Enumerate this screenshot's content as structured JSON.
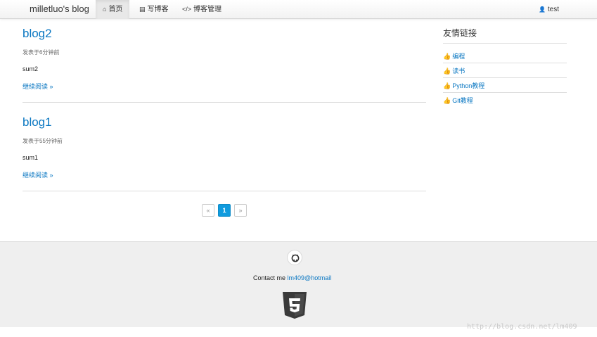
{
  "navbar": {
    "brand": "milletluo's blog",
    "items": [
      {
        "label": "首页",
        "icon": "home-icon",
        "glyph": "⌂",
        "active": true
      },
      {
        "label": "写博客",
        "icon": "book-icon",
        "glyph": "▤",
        "active": false
      },
      {
        "label": "博客管理",
        "icon": "code-icon",
        "glyph": "</>",
        "active": false
      }
    ],
    "user": {
      "icon": "user-icon",
      "glyph": "👤",
      "name": "test"
    }
  },
  "posts": [
    {
      "title": "blog2",
      "meta": "发表于6分钟前",
      "summary": "sum2",
      "read_more": "继续阅读 »"
    },
    {
      "title": "blog1",
      "meta": "发表于55分钟前",
      "summary": "sum1",
      "read_more": "继续阅读 »"
    }
  ],
  "pagination": {
    "prev": "«",
    "current": "1",
    "next": "»"
  },
  "sidebar": {
    "title": "友情链接",
    "links": [
      {
        "label": "编程",
        "icon": "thumbs-up-icon"
      },
      {
        "label": "读书",
        "icon": "thumbs-up-icon"
      },
      {
        "label": "Python教程",
        "icon": "thumbs-up-icon"
      },
      {
        "label": "Git教程",
        "icon": "thumbs-up-icon"
      }
    ],
    "link_glyph": "👍"
  },
  "footer": {
    "contact_label": "Contact me",
    "contact_email": "lm409@hotmail",
    "github_icon": "github-icon",
    "html5_icon": "html5-logo"
  },
  "watermark": "http://blog.csdn.net/lm409"
}
